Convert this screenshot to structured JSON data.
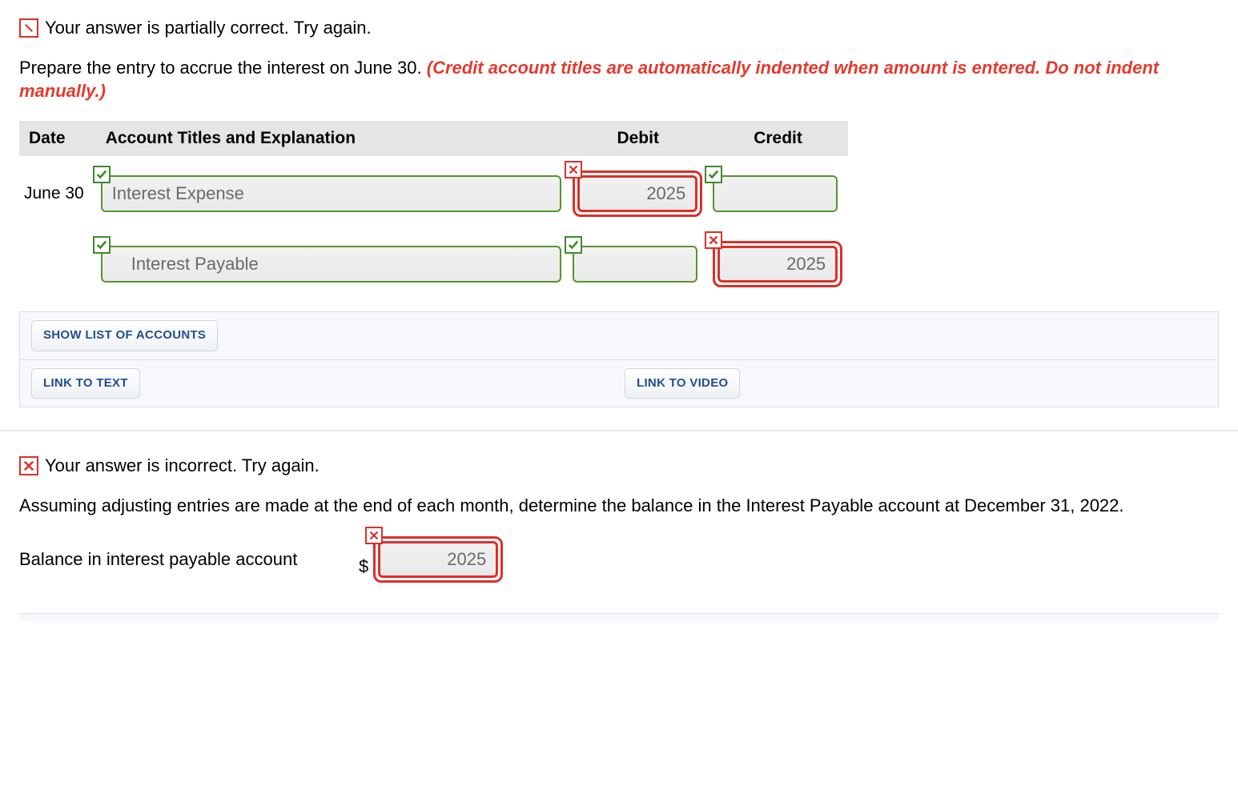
{
  "section1": {
    "feedback": "Your answer is partially correct.  Try again.",
    "prompt_plain": "Prepare the entry to accrue the interest on June 30. ",
    "prompt_hint": "(Credit account titles are automatically indented when amount is entered. Do not indent manually.)",
    "headers": {
      "date": "Date",
      "acct": "Account Titles and Explanation",
      "debit": "Debit",
      "credit": "Credit"
    },
    "rows": [
      {
        "date": "June 30",
        "acct": {
          "value": "Interest Expense",
          "status": "correct",
          "indent": false
        },
        "debit": {
          "value": "2025",
          "status": "wrong"
        },
        "credit": {
          "value": "",
          "status": "correct"
        }
      },
      {
        "date": "",
        "acct": {
          "value": "Interest Payable",
          "status": "correct",
          "indent": true
        },
        "debit": {
          "value": "",
          "status": "correct"
        },
        "credit": {
          "value": "2025",
          "status": "wrong"
        }
      }
    ],
    "buttons": {
      "show_list": "SHOW LIST OF ACCOUNTS",
      "link_text": "LINK TO TEXT",
      "link_video": "LINK TO VIDEO"
    }
  },
  "section2": {
    "feedback": "Your answer is incorrect.  Try again.",
    "prompt": "Assuming adjusting entries are made at the end of each month, determine the balance in the Interest Payable account at December 31, 2022.",
    "balance_label": "Balance in interest payable account",
    "currency": "$",
    "balance": {
      "value": "2025",
      "status": "wrong"
    }
  }
}
